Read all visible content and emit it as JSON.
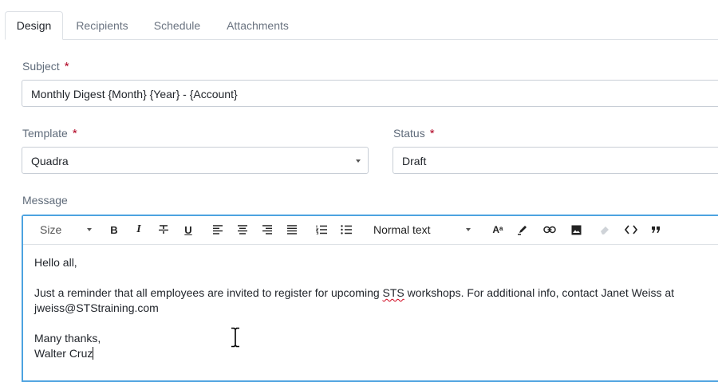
{
  "tabs": [
    {
      "label": "Design",
      "active": true
    },
    {
      "label": "Recipients",
      "active": false
    },
    {
      "label": "Schedule",
      "active": false
    },
    {
      "label": "Attachments",
      "active": false
    }
  ],
  "form": {
    "subject_label": "Subject",
    "subject_value": "Monthly Digest {Month} {Year} - {Account}",
    "template_label": "Template",
    "template_value": "Quadra",
    "status_label": "Status",
    "status_value": "Draft",
    "message_label": "Message",
    "required_mark": "*"
  },
  "toolbar": {
    "size_label": "Size",
    "bold": "B",
    "italic": "I",
    "underline": "U",
    "block_format": "Normal text",
    "font_size_icon": "Aᵃ"
  },
  "message": {
    "line1": "Hello all,",
    "line2a": "Just a reminder that all employees are invited to register for upcoming ",
    "line2_misspelled": "STS",
    "line2b": " workshops. For additional info, contact Janet Weiss at",
    "line3": "jweiss@STStraining.com",
    "line4": "Many thanks,",
    "line5": "Walter Cruz"
  },
  "colors": {
    "focus_border": "#4da3e0",
    "required_star": "#b00020",
    "spellcheck_underline": "#d0021b"
  }
}
